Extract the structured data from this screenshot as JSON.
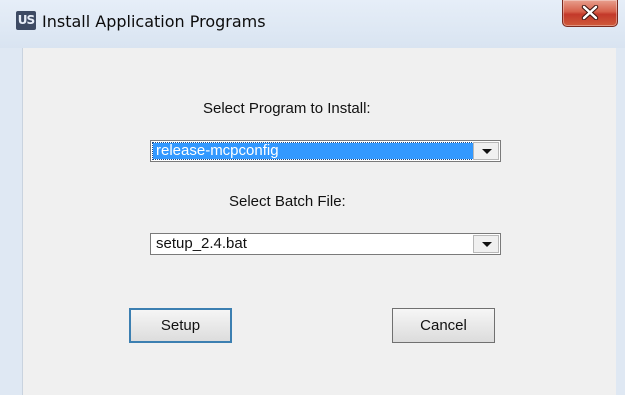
{
  "window": {
    "title": "Install Application Programs",
    "icon": "app-logo-icon",
    "icon_text": "US"
  },
  "program": {
    "label": "Select Program to Install:",
    "selected": "release-mcpconfig"
  },
  "batch": {
    "label": "Select Batch File:",
    "selected": "setup_2.4.bat"
  },
  "buttons": {
    "setup": "Setup",
    "cancel": "Cancel"
  },
  "colors": {
    "selection": "#3399ff",
    "close_button": "#c3392a"
  }
}
